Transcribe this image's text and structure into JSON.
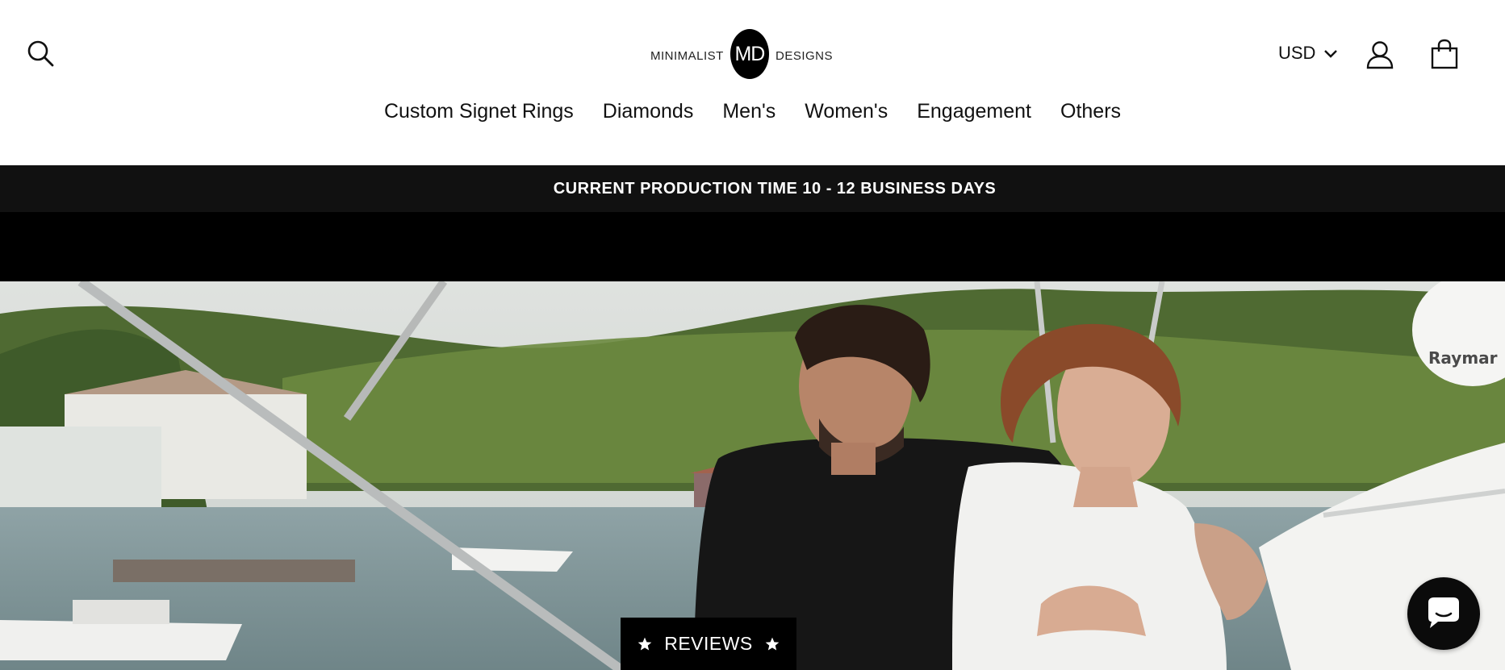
{
  "header": {
    "logo": {
      "left": "MINIMALIST",
      "center": "MD",
      "right": "DESIGNS"
    },
    "currency": {
      "value": "USD"
    },
    "icons": {
      "search": "search-icon",
      "account": "user-icon",
      "cart": "shopping-bag-icon",
      "currency_toggle": "chevron-down-icon"
    }
  },
  "nav": {
    "items": [
      {
        "label": "Custom Signet Rings"
      },
      {
        "label": "Diamonds"
      },
      {
        "label": "Men's"
      },
      {
        "label": "Women's"
      },
      {
        "label": "Engagement"
      },
      {
        "label": "Others"
      }
    ]
  },
  "announcement": {
    "text": "CURRENT PRODUCTION TIME 10 - 12 BUSINESS DAYS"
  },
  "hero": {
    "boat_brand": "Raymar",
    "description_icons": [
      "boat-photo"
    ]
  },
  "reviews_tab": {
    "label": "REVIEWS",
    "icon": "star-icon"
  },
  "chat": {
    "icon": "chat-bubble-icon"
  },
  "colors": {
    "announcement_bg": "#111111",
    "band_bg": "#000000",
    "text": "#111111"
  }
}
